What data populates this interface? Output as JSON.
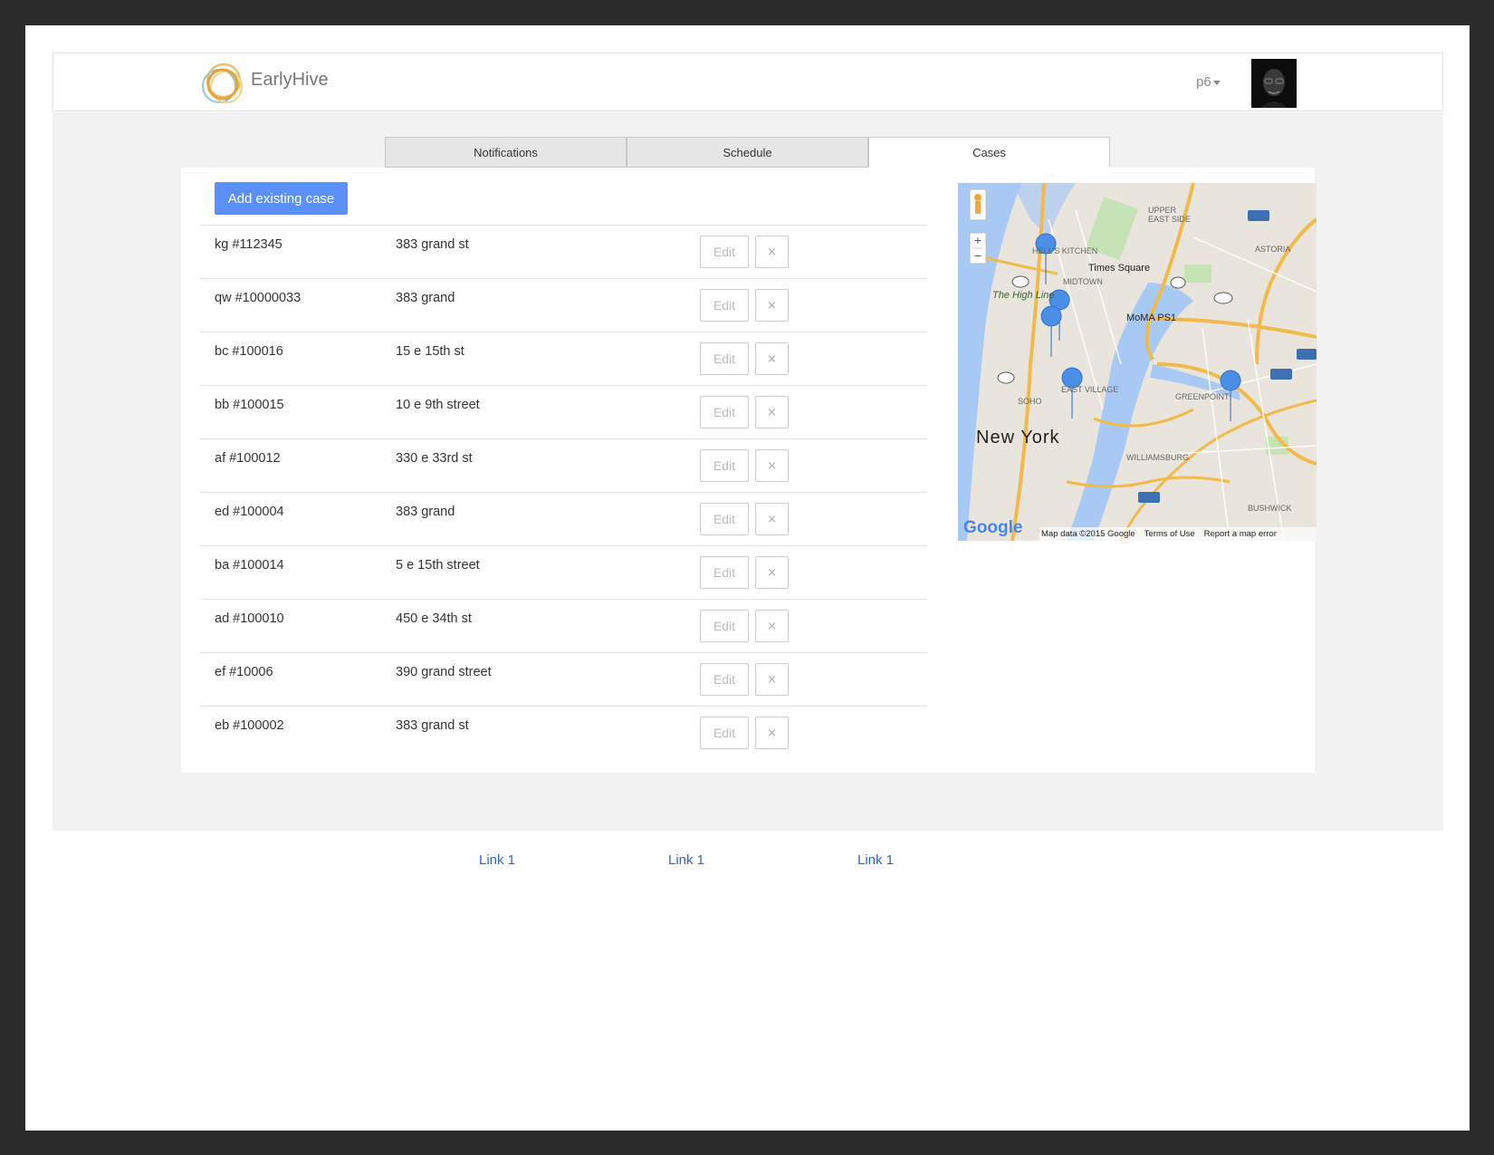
{
  "header": {
    "brand": "EarlyHive",
    "user_label": "p6"
  },
  "tabs": [
    {
      "label": "Notifications",
      "active": false
    },
    {
      "label": "Schedule",
      "active": false
    },
    {
      "label": "Cases",
      "active": true
    }
  ],
  "cases": {
    "add_label": "Add existing case",
    "edit_label": "Edit",
    "delete_label": "×",
    "rows": [
      {
        "id": "kg #112345",
        "address": "383 grand st"
      },
      {
        "id": "qw #10000033",
        "address": "383 grand"
      },
      {
        "id": "bc #100016",
        "address": "15 e 15th st"
      },
      {
        "id": "bb #100015",
        "address": "10 e 9th street"
      },
      {
        "id": "af #100012",
        "address": "330 e 33rd st"
      },
      {
        "id": "ed #100004",
        "address": "383 grand"
      },
      {
        "id": "ba #100014",
        "address": "5 e 15th street"
      },
      {
        "id": "ad #100010",
        "address": "450 e 34th st"
      },
      {
        "id": "ef #10006",
        "address": "390 grand street"
      },
      {
        "id": "eb #100002",
        "address": "383 grand st"
      }
    ]
  },
  "map": {
    "zoom_in": "+",
    "zoom_out": "−",
    "city_label": "New York",
    "place_labels": {
      "times_square": "Times Square",
      "high_line": "The High Line",
      "moma": "MoMA PS1",
      "midtown": "MIDTOWN",
      "east_village": "EAST VILLAGE",
      "soho": "SOHO",
      "williamsburg": "WILLIAMSBURG",
      "greenpoint": "GREENPOINT",
      "astoria": "ASTORIA",
      "upper_east_side": "UPPER EAST SIDE",
      "hells_kitchen": "HELL'S KITCHEN",
      "bushwick": "BUSHWICK"
    },
    "attribution": {
      "logo": "Google",
      "data": "Map data ©2015 Google",
      "terms": "Terms of Use",
      "report": "Report a map error"
    },
    "colors": {
      "land": "#e9e5dc",
      "water": "#a9c9f5",
      "park": "#c5e3b4",
      "highway": "#f2b94b",
      "marker": "#4a8ee6"
    }
  },
  "footer": {
    "links": [
      "Link 1",
      "Link 1",
      "Link 1"
    ]
  }
}
